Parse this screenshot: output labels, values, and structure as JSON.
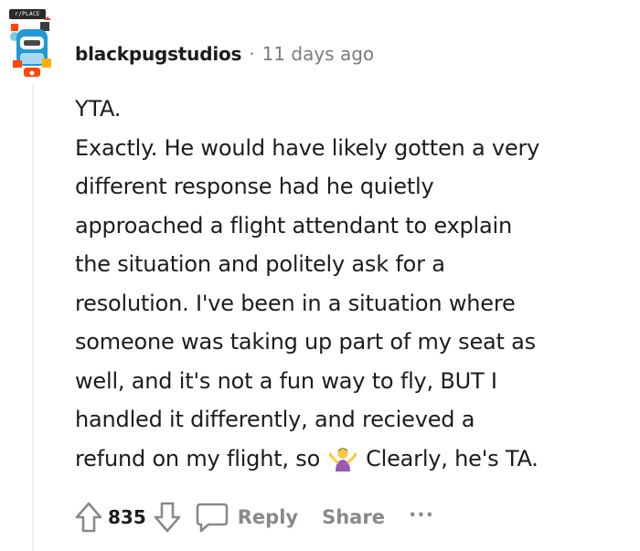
{
  "comment": {
    "author": "blackpugstudios",
    "separator": "·",
    "timestamp": "11 days ago",
    "avatar_flair": "r/PLACE",
    "body_lines": [
      "YTA.",
      "Exactly. He would have likely gotten a very",
      "different response had he quietly",
      "approached a flight attendant to explain",
      "the situation and politely ask for a",
      "resolution. I've been in a situation where",
      "someone was taking up part of my seat as",
      "well, and it's not a fun way to fly, BUT I",
      "handled it differently, and recieved a"
    ],
    "last_line_before_emoji": "refund on my flight, so",
    "last_line_after_emoji": "Clearly, he's TA.",
    "emoji_icon": "person-shrugging-emoji"
  },
  "actions": {
    "upvote_icon": "upvote-arrow-icon",
    "score": "835",
    "downvote_icon": "downvote-arrow-icon",
    "reply_icon": "speech-bubble-icon",
    "reply_label": "Reply",
    "share_label": "Share",
    "more_label": "..."
  },
  "colors": {
    "text": "#1c1c1c",
    "meta": "#7c7c7c",
    "action": "#878a8c",
    "thread_line": "#edeff1"
  }
}
